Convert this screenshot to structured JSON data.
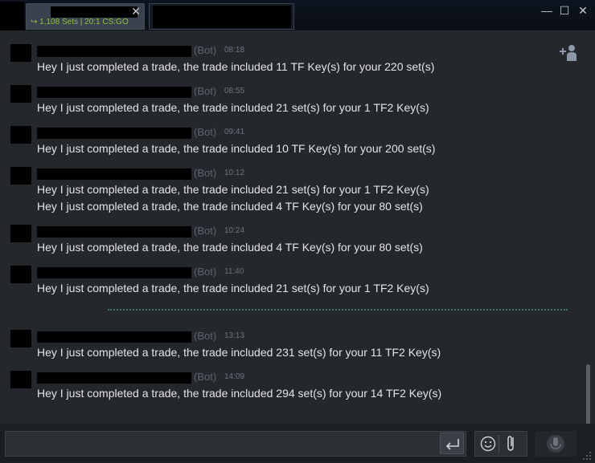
{
  "window": {
    "active_tab": {
      "status": "↪ 1,108 Sets | 20:1 CS:GO"
    },
    "controls": {
      "minimize": "—",
      "maximize": "☐",
      "close": "✕"
    }
  },
  "messages": [
    {
      "bot": "(Bot)",
      "time": "08:18",
      "lines": [
        "Hey I just completed a trade, the trade included 11 TF Key(s) for your 220 set(s)"
      ]
    },
    {
      "bot": "(Bot)",
      "time": "08:55",
      "lines": [
        "Hey I just completed a trade, the trade included 21 set(s) for your 1 TF2 Key(s)"
      ]
    },
    {
      "bot": "(Bot)",
      "time": "09:41",
      "lines": [
        "Hey I just completed a trade, the trade included 10 TF Key(s) for your 200 set(s)"
      ]
    },
    {
      "bot": "(Bot)",
      "time": "10:12",
      "lines": [
        "Hey I just completed a trade, the trade included 21 set(s) for your 1 TF2 Key(s)",
        "Hey I just completed a trade, the trade included 4 TF Key(s) for your 80 set(s)"
      ]
    },
    {
      "bot": "(Bot)",
      "time": "10:24",
      "lines": [
        "Hey I just completed a trade, the trade included 4 TF Key(s) for your 80 set(s)"
      ]
    },
    {
      "bot": "(Bot)",
      "time": "11:40",
      "lines": [
        "Hey I just completed a trade, the trade included 21 set(s) for your 1 TF2 Key(s)"
      ]
    },
    {
      "bot": "(Bot)",
      "time": "13:13",
      "lines": [
        "Hey I just completed a trade, the trade included 231 set(s) for your 11 TF2 Key(s)"
      ]
    },
    {
      "bot": "(Bot)",
      "time": "14:09",
      "lines": [
        "Hey I just completed a trade, the trade included 294 set(s) for your 14 TF2 Key(s)"
      ]
    }
  ],
  "input": {
    "value": "",
    "placeholder": ""
  },
  "icons": {
    "add_friend": "add-friend-icon",
    "send": "enter-icon",
    "emoji": "smiley-icon",
    "attach": "paperclip-icon",
    "voice": "microphone-icon"
  },
  "colors": {
    "status_green": "#8fbf3f",
    "divider": "#3f6f6e",
    "background": "#24272c"
  }
}
